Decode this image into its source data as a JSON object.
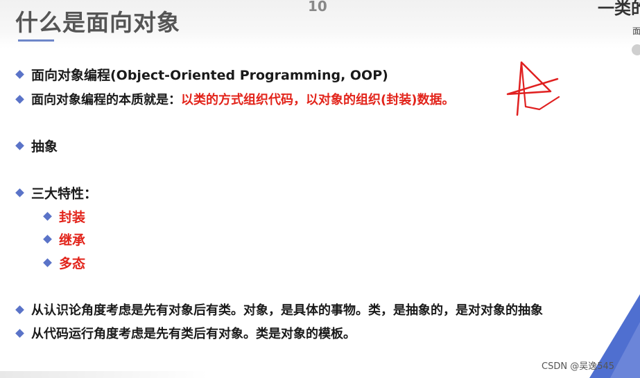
{
  "slide": {
    "title": "什么是面向对象",
    "page_number": "10",
    "corner_heading": "一类的",
    "corner_sub": "面"
  },
  "bullets": [
    {
      "text": "面向对象编程(Object-Oriented Programming, OOP)"
    },
    {
      "lead": "面向对象编程的本质就是：",
      "highlight": "以类的方式组织代码，以对象的组织(封装)数据。"
    },
    {
      "text": "抽象"
    },
    {
      "text": "三大特性："
    },
    {
      "text": "从认识论角度考虑是先有对象后有类。对象，是具体的事物。类，是抽象的，是对对象的抽象"
    },
    {
      "text": "从代码运行角度考虑是先有类后有对象。类是对象的模板。"
    }
  ],
  "sub_bullets": [
    {
      "text": "封装"
    },
    {
      "text": "继承"
    },
    {
      "text": "多态"
    }
  ],
  "watermark": "CSDN @吴逸545",
  "colors": {
    "bullet": "#5a73c8",
    "highlight": "#e2231a",
    "title": "#555555",
    "annotation": "#e02020",
    "corner_triangle": "#4f6fd0"
  }
}
